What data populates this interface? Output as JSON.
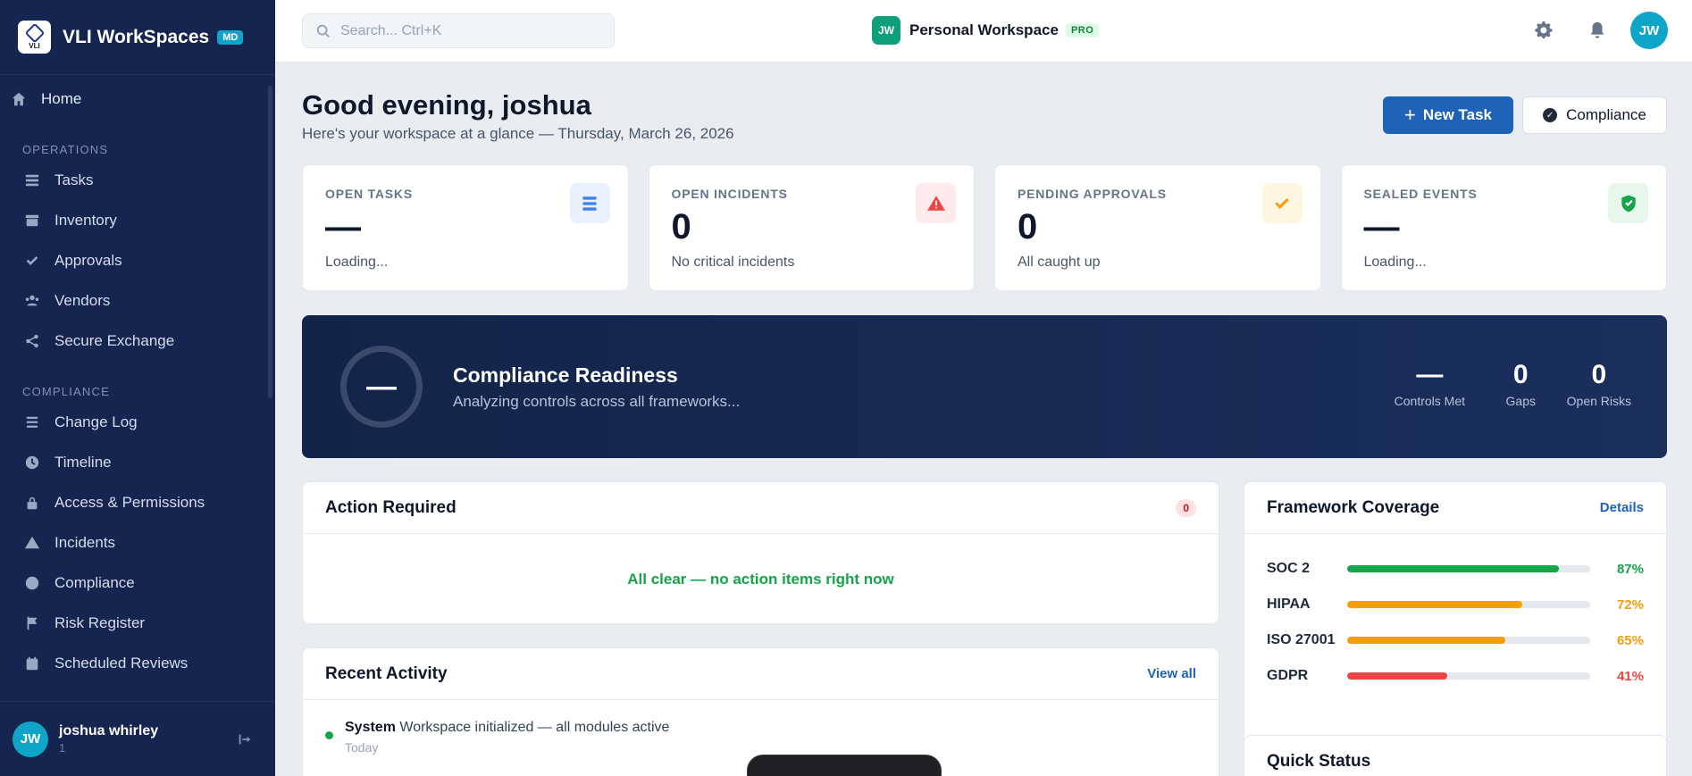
{
  "app": {
    "title": "VLI WorkSpaces",
    "badge": "MD",
    "logo_text": "VLI"
  },
  "sidebar": {
    "home": {
      "label": "Home",
      "icon": "home-icon"
    },
    "sections": [
      {
        "label": "OPERATIONS",
        "items": [
          {
            "label": "Tasks",
            "icon": "tasks-icon"
          },
          {
            "label": "Inventory",
            "icon": "inventory-icon"
          },
          {
            "label": "Approvals",
            "icon": "check-icon"
          },
          {
            "label": "Vendors",
            "icon": "vendors-icon"
          },
          {
            "label": "Secure Exchange",
            "icon": "share-icon"
          }
        ]
      },
      {
        "label": "COMPLIANCE",
        "items": [
          {
            "label": "Change Log",
            "icon": "list-icon"
          },
          {
            "label": "Timeline",
            "icon": "clock-icon"
          },
          {
            "label": "Access & Permissions",
            "icon": "lock-icon"
          },
          {
            "label": "Incidents",
            "icon": "warning-icon"
          },
          {
            "label": "Compliance",
            "icon": "check-circle-icon"
          },
          {
            "label": "Risk Register",
            "icon": "flag-icon"
          },
          {
            "label": "Scheduled Reviews",
            "icon": "calendar-icon"
          }
        ]
      }
    ],
    "user": {
      "initials": "JW",
      "name": "joshua whirley",
      "sub": "1"
    }
  },
  "topbar": {
    "search_placeholder": "Search...  Ctrl+K",
    "workspace": {
      "initials": "JW",
      "name": "Personal Workspace",
      "badge": "PRO"
    },
    "user_initials": "JW"
  },
  "main": {
    "greeting": "Good evening, joshua",
    "subline": "Here's your workspace at a glance — Thursday, March 26, 2026",
    "new_task_label": "New Task",
    "compliance_label": "Compliance",
    "stats": [
      {
        "label": "OPEN TASKS",
        "value": "—",
        "sub": "Loading...",
        "icon": "tasks-icon",
        "color": "#3b82f6",
        "bg": "#e8f0fe"
      },
      {
        "label": "OPEN INCIDENTS",
        "value": "0",
        "sub": "No critical incidents",
        "icon": "warning-icon",
        "color": "#ef4444",
        "bg": "#fdeaea"
      },
      {
        "label": "PENDING APPROVALS",
        "value": "0",
        "sub": "All caught up",
        "icon": "check-icon",
        "color": "#f59e0b",
        "bg": "#fef6e0"
      },
      {
        "label": "SEALED EVENTS",
        "value": "—",
        "sub": "Loading...",
        "icon": "shield-icon",
        "color": "#16a34a",
        "bg": "#e7f7ec"
      }
    ],
    "readiness": {
      "ring_value": "—",
      "title": "Compliance Readiness",
      "subtitle": "Analyzing controls across all frameworks...",
      "stats": [
        {
          "value": "—",
          "label": "Controls Met"
        },
        {
          "value": "0",
          "label": "Gaps"
        },
        {
          "value": "0",
          "label": "Open Risks"
        }
      ]
    },
    "action_required": {
      "title": "Action Required",
      "count": "0",
      "empty": "All clear — no action items right now"
    },
    "recent_activity": {
      "title": "Recent Activity",
      "view_all": "View all",
      "items": [
        {
          "actor": "System",
          "text": "Workspace initialized — all modules active",
          "time": "Today"
        }
      ]
    },
    "framework_coverage": {
      "title": "Framework Coverage",
      "details": "Details",
      "items": [
        {
          "name": "SOC 2",
          "pct_label": "87%",
          "pct": 0.87,
          "color": "#16a34a"
        },
        {
          "name": "HIPAA",
          "pct_label": "72%",
          "pct": 0.72,
          "color": "#f59e0b"
        },
        {
          "name": "ISO 27001",
          "pct_label": "65%",
          "pct": 0.65,
          "color": "#f59e0b"
        },
        {
          "name": "GDPR",
          "pct_label": "41%",
          "pct": 0.41,
          "color": "#ef4444"
        }
      ]
    },
    "quick_status": {
      "title": "Quick Status"
    }
  }
}
